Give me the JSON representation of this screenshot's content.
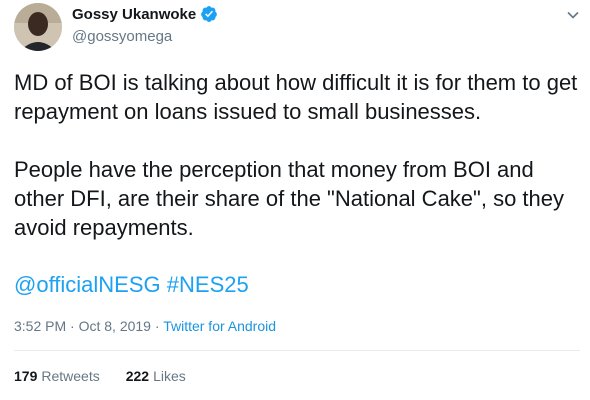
{
  "author": {
    "display_name": "Gossy Ukanwoke",
    "handle": "@gossyomega",
    "verified": true
  },
  "tweet": {
    "paragraph1": "MD of BOI is talking about how difficult it is for them to get repayment on loans issued to small businesses.",
    "paragraph2": "People have the perception that money from BOI and other DFI, are their share of the \"National Cake\", so they avoid repayments.",
    "mentions": [
      "@officialNESG",
      "#NES25"
    ]
  },
  "meta": {
    "time": "3:52 PM",
    "separator": "·",
    "date": "Oct 8, 2019",
    "source": "Twitter for Android"
  },
  "stats": {
    "retweets_count": "179",
    "retweets_label": "Retweets",
    "likes_count": "222",
    "likes_label": "Likes"
  },
  "colors": {
    "link": "#1da1f2",
    "secondary_text": "#657786",
    "primary_text": "#14171a"
  },
  "icons": [
    "verified-badge-icon",
    "chevron-down-icon"
  ]
}
